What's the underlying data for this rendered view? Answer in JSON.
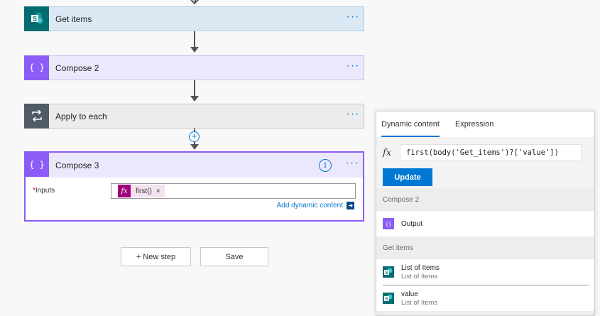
{
  "flow": {
    "cards": [
      {
        "id": "get-items",
        "title": "Get items"
      },
      {
        "id": "compose-2",
        "title": "Compose 2"
      },
      {
        "id": "apply-to-each",
        "title": "Apply to each"
      }
    ],
    "more_label": "···",
    "compose3": {
      "title": "Compose 3",
      "inputs_required_mark": "*",
      "inputs_label": "Inputs",
      "token_fx": "fx",
      "token_label": "first()",
      "token_close": "×",
      "add_dynamic": "Add dynamic content",
      "info_label": "i"
    },
    "plus_label": "+",
    "buttons": {
      "new_step": "+ New step",
      "save": "Save"
    }
  },
  "panel": {
    "tabs": [
      "Dynamic content",
      "Expression"
    ],
    "active_tab": 0,
    "expr_fx": "fx",
    "expression": "first(body('Get_items')?['value'])",
    "update_label": "Update",
    "sections": [
      {
        "header": "Compose 2",
        "items": [
          {
            "title": "Output",
            "subtitle": "",
            "icon": "compose-icon"
          }
        ]
      },
      {
        "header": "Get items",
        "items": [
          {
            "title": "List of Items",
            "subtitle": "List of Items",
            "icon": "sharepoint-icon"
          },
          {
            "title": "value",
            "subtitle": "List of Items",
            "icon": "sharepoint-icon"
          }
        ]
      }
    ]
  },
  "colors": {
    "accent": "#0078d4",
    "compose": "#8b5cf6",
    "sharepoint": "#036c70",
    "apply": "#4f5b66",
    "token": "#a1007a"
  }
}
